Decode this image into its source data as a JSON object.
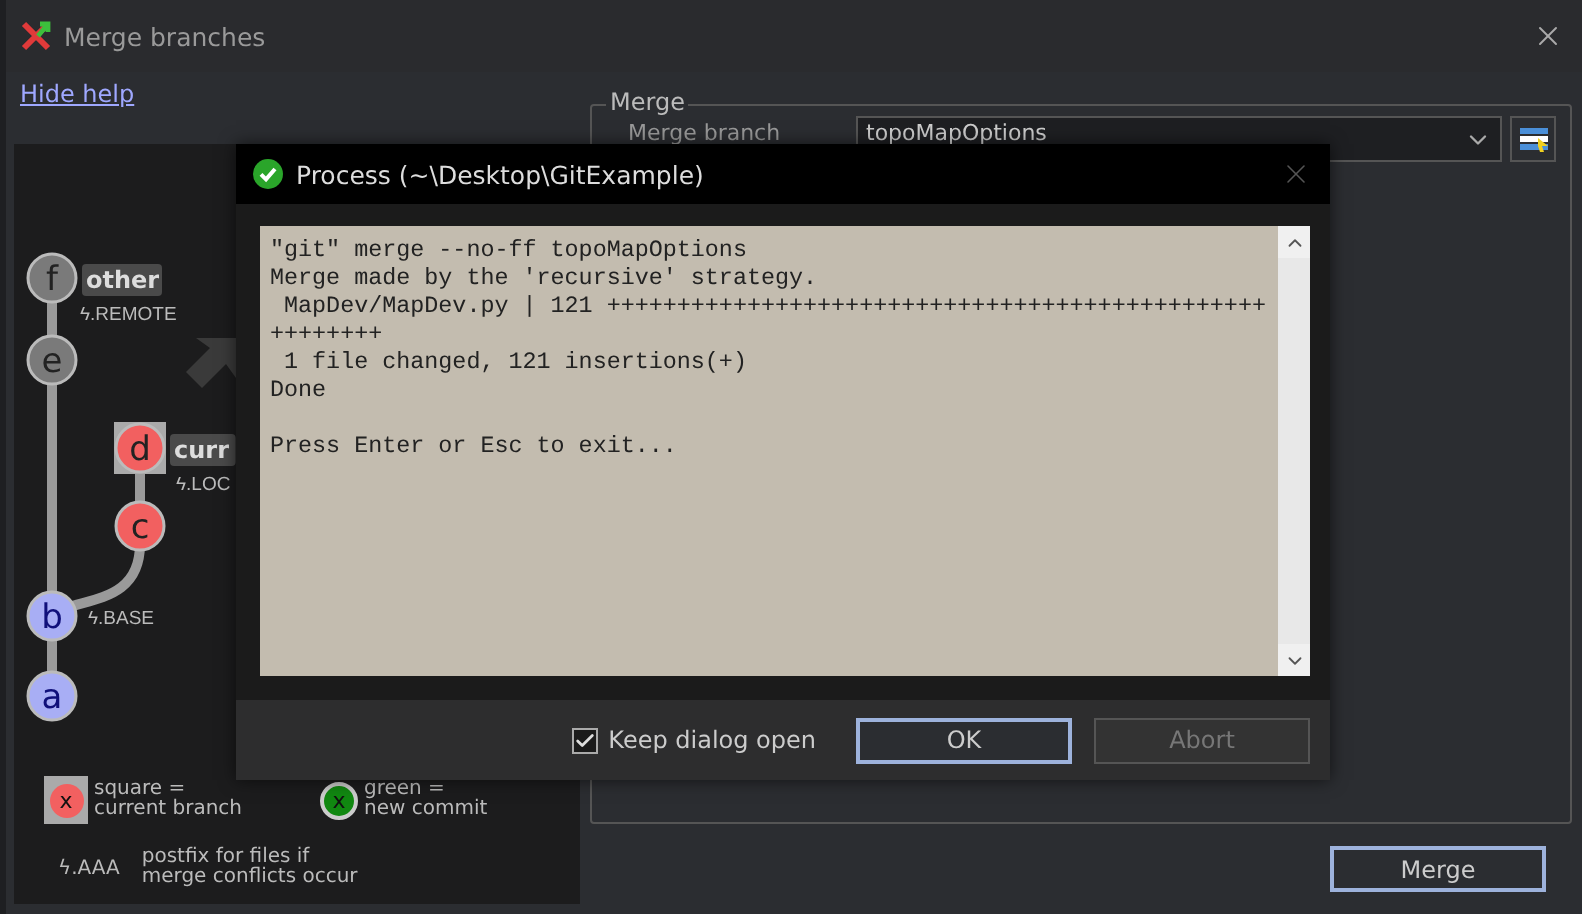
{
  "window": {
    "title": "Merge branches"
  },
  "help_link": "Hide help",
  "help": {
    "nodes": [
      {
        "label": "f",
        "color": "#7a7a7a",
        "squared": false
      },
      {
        "label": "e",
        "color": "#7a7a7a",
        "squared": false
      },
      {
        "label": "d",
        "color": "#f26060",
        "squared": true
      },
      {
        "label": "c",
        "color": "#f26060",
        "squared": false
      },
      {
        "label": "b",
        "color": "#a8aef5",
        "squared": false
      },
      {
        "label": "a",
        "color": "#a8aef5",
        "squared": false
      }
    ],
    "tags": [
      {
        "text": "other",
        "kind": "branch"
      },
      {
        "text": "ϟ.REMOTE",
        "kind": "postfix"
      },
      {
        "text": "curr",
        "kind": "branch"
      },
      {
        "text": "ϟ.LOC",
        "kind": "postfix"
      },
      {
        "text": "ϟ.BASE",
        "kind": "postfix"
      }
    ],
    "legend": [
      {
        "mark": "x",
        "kind": "square",
        "lines": [
          "square =",
          "current branch"
        ]
      },
      {
        "mark": "x",
        "kind": "circle",
        "lines": [
          "green =",
          "new commit"
        ]
      },
      {
        "mark": "ϟ.AAA",
        "kind": "postfix",
        "lines": [
          "postfix for files if",
          "merge conflicts occur"
        ]
      }
    ]
  },
  "merge": {
    "legend": "Merge",
    "branch_label": "Merge branch",
    "branch": "topoMapOptions"
  },
  "merge_button": "Merge",
  "process": {
    "title": "Process (~\\Desktop\\GitExample)",
    "output": [
      [
        "\"git\" merge --no-ff topoMapOptions",
        "Merge made by the 'recursive' strategy.",
        " MapDev/MapDev.py | 121 +++++++++++++++++++++++++++++++++++++++++++++++",
        "++++++++",
        " 1 file changed, 121 insertions(+)",
        "Done"
      ],
      [
        "Press Enter or Esc to exit..."
      ]
    ],
    "keep_open": {
      "label": "Keep dialog open",
      "checked": true
    },
    "buttons": [
      {
        "label": "OK",
        "kind": "default",
        "disabled": false
      },
      {
        "label": "Abort",
        "kind": "normal",
        "disabled": true
      }
    ]
  }
}
